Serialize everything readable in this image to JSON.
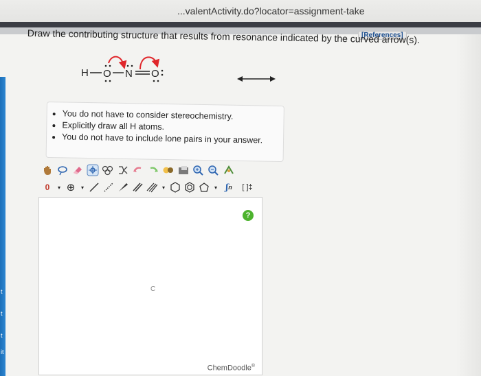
{
  "browser": {
    "url_fragment": "...valentActivity.do?locator=assignment-take"
  },
  "header": {
    "references_label": "[References]"
  },
  "question": {
    "instruction": "Draw the contributing structure that results from resonance indicated by the curved arrow(s).",
    "molecule_atoms": {
      "h": "H",
      "o1": "O",
      "n": "N",
      "o2": "O"
    },
    "notes": [
      "You do not have to consider stereochemistry.",
      "Explicitly draw all H atoms.",
      "You do not have to include lone pairs in your answer."
    ]
  },
  "editor": {
    "charge_label": "0",
    "repeat_label": "n",
    "bracket_label": "[ ]‡",
    "help_label": "?",
    "canvas_center_label": "C",
    "brand": "ChemDoodle",
    "brand_mark": "®"
  },
  "left_strip_marks": [
    "t",
    "t",
    "t",
    "it"
  ],
  "colors": {
    "arrow_red": "#e0262b",
    "help_green": "#4db32e",
    "strip_blue": "#1c6fb8"
  }
}
